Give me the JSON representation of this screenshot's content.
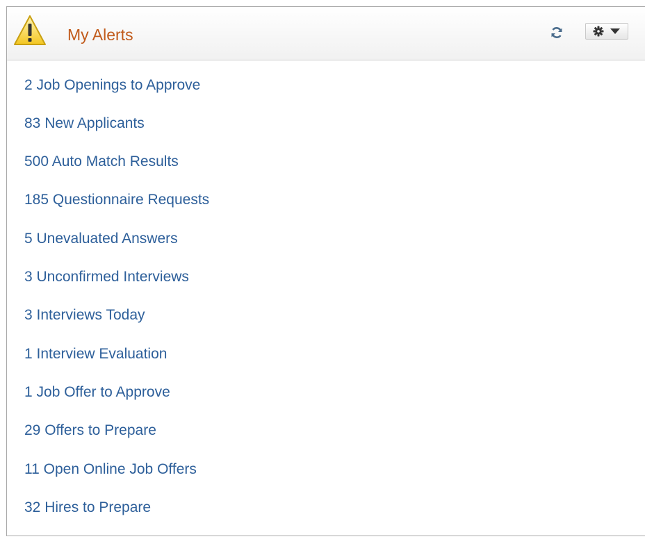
{
  "pagelet": {
    "title": "My Alerts",
    "header_icon": "warning-triangle-icon",
    "refresh_icon": "refresh-icon",
    "actions_icon": "gear-dropdown-icon",
    "title_color": "#c15b1c",
    "link_color": "#2d5f9a"
  },
  "alerts": [
    {
      "label": "2 Job Openings to Approve"
    },
    {
      "label": "83 New Applicants"
    },
    {
      "label": "500 Auto Match Results"
    },
    {
      "label": "185 Questionnaire Requests"
    },
    {
      "label": "5 Unevaluated Answers"
    },
    {
      "label": "3 Unconfirmed Interviews"
    },
    {
      "label": "3 Interviews Today"
    },
    {
      "label": "1 Interview Evaluation"
    },
    {
      "label": "1 Job Offer to Approve"
    },
    {
      "label": "29 Offers to Prepare"
    },
    {
      "label": "11 Open Online Job Offers"
    },
    {
      "label": "32 Hires to Prepare"
    }
  ]
}
